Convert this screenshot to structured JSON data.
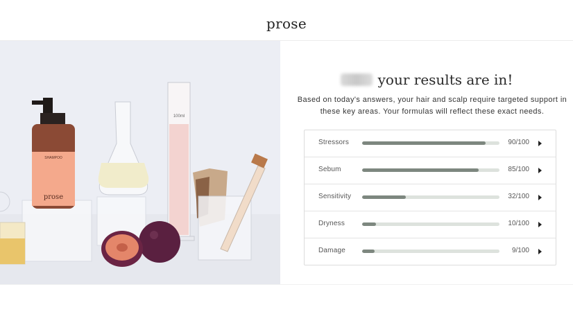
{
  "header": {
    "logo": "prose"
  },
  "panel": {
    "heading": "your results are in!",
    "description": "Based on today's answers, your hair and scalp require targeted support in these key areas. Your formulas will reflect these exact needs.",
    "results": [
      {
        "label": "Stressors",
        "score": "90/100",
        "level": 0.9
      },
      {
        "label": "Sebum",
        "score": "85/100",
        "level": 0.85
      },
      {
        "label": "Sensitivity",
        "score": "32/100",
        "level": 0.32
      },
      {
        "label": "Dryness",
        "score": "10/100",
        "level": 0.1
      },
      {
        "label": "Damage",
        "score": "9/100",
        "level": 0.09
      }
    ]
  },
  "hero": {
    "bottle_text": "SHAMPOO",
    "bottle_logo": "prose",
    "cylinder_text": "100ml"
  },
  "colors": {
    "bar_fill": "#7d877f",
    "bar_track": "#dde2dd",
    "hero_bg": "#eceef4",
    "bottle_label": "#f4a98c",
    "plum": "#5a2040"
  }
}
